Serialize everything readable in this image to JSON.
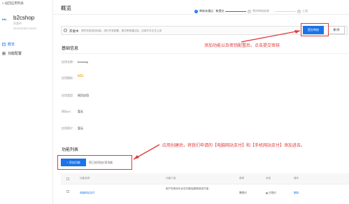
{
  "sidebar": {
    "back_label": "< 返回应用列表",
    "app_logo": "b2c",
    "app_name": "b2cshop",
    "app_status": "开发中",
    "app_id": "2019091587124871",
    "nav": [
      {
        "label": "概览",
        "icon": "overview-icon"
      },
      {
        "label": "功能配置",
        "icon": "function-config-icon"
      }
    ]
  },
  "header": {
    "title": "概览",
    "steps": [
      {
        "num": "1",
        "label": "审核未通过 · 新提交"
      },
      {
        "num": "2",
        "label": "等待审核结果"
      },
      {
        "num": "3",
        "label": "上线"
      }
    ]
  },
  "dev_bar": {
    "label": "开发中",
    "text": "请先完成添加功能、进行开发配置，提交审核通过后，应用才可正式上线",
    "submit_label": "提交审核",
    "delete_label": "删 除"
  },
  "annotations": {
    "top": "添加功能以及密钥配置后，点击提交审核",
    "bottom": "应用创建后，将我们申请的【电脑网站支付】和【手机网站支付】添加进去。",
    "color": "#e03a3a"
  },
  "basic_info": {
    "title": "基础信息",
    "rows": [
      {
        "label": "应用名称：",
        "value": "b2cshop"
      },
      {
        "label": "应用图标：",
        "value": "b2c"
      },
      {
        "label": "应用类型：",
        "value": "网页应用"
      },
      {
        "label": "网站url：",
        "value": "暂无"
      },
      {
        "label": "应用简介：",
        "value": "暂无"
      }
    ]
  },
  "functions": {
    "title": "功能列表",
    "add_label": "+ 添加功能",
    "add_hint": "您已经添加0项功能",
    "columns": [
      "功能名称",
      "功能介绍",
      "费率",
      "状态",
      "操作"
    ],
    "rows": [
      {
        "name": "电脑网站支付",
        "description": "用户在网页中点击付款后跳转到支付宝…",
        "fee": "需签约",
        "status": "已签约",
        "action": "删除"
      }
    ]
  },
  "colors": {
    "accent": "#1a73e8",
    "annotation": "#e03a3a"
  }
}
